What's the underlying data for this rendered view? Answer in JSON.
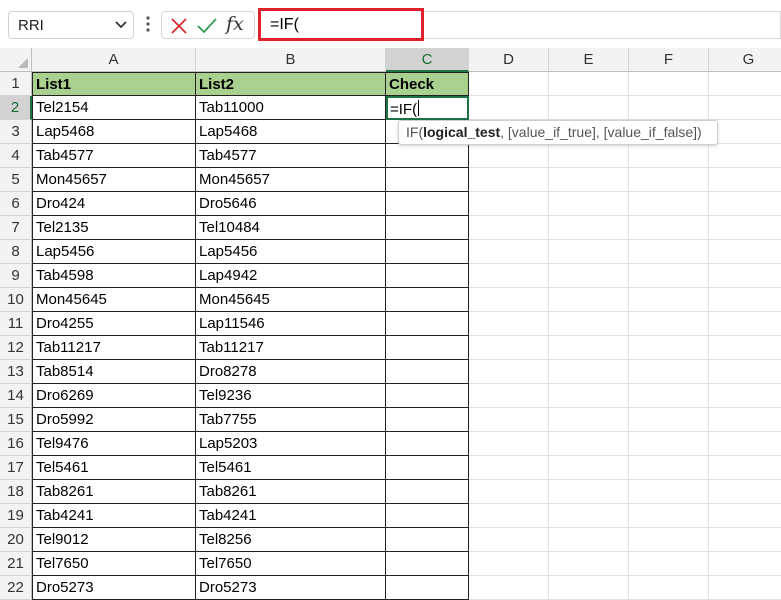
{
  "formula_bar": {
    "name_box": "RRI",
    "fx_label": "fx",
    "formula": "=IF("
  },
  "columns": [
    "A",
    "B",
    "C",
    "D",
    "E",
    "F",
    "G"
  ],
  "active_column": "C",
  "active_row": 2,
  "headers": [
    "List1",
    "List2",
    "Check"
  ],
  "rows": [
    {
      "num": "1",
      "a": "List1",
      "b": "List2",
      "c": "Check"
    },
    {
      "num": "2",
      "a": "Tel2154",
      "b": "Tab11000",
      "c": "=IF("
    },
    {
      "num": "3",
      "a": "Lap5468",
      "b": "Lap5468",
      "c": ""
    },
    {
      "num": "4",
      "a": "Tab4577",
      "b": "Tab4577",
      "c": ""
    },
    {
      "num": "5",
      "a": "Mon45657",
      "b": "Mon45657",
      "c": ""
    },
    {
      "num": "6",
      "a": "Dro424",
      "b": "Dro5646",
      "c": ""
    },
    {
      "num": "7",
      "a": "Tel2135",
      "b": "Tel10484",
      "c": ""
    },
    {
      "num": "8",
      "a": "Lap5456",
      "b": "Lap5456",
      "c": ""
    },
    {
      "num": "9",
      "a": "Tab4598",
      "b": "Lap4942",
      "c": ""
    },
    {
      "num": "10",
      "a": "Mon45645",
      "b": "Mon45645",
      "c": ""
    },
    {
      "num": "11",
      "a": "Dro4255",
      "b": "Lap11546",
      "c": ""
    },
    {
      "num": "12",
      "a": "Tab11217",
      "b": "Tab11217",
      "c": ""
    },
    {
      "num": "13",
      "a": "Tab8514",
      "b": "Dro8278",
      "c": ""
    },
    {
      "num": "14",
      "a": "Dro6269",
      "b": "Tel9236",
      "c": ""
    },
    {
      "num": "15",
      "a": "Dro5992",
      "b": "Tab7755",
      "c": ""
    },
    {
      "num": "16",
      "a": "Tel9476",
      "b": "Lap5203",
      "c": ""
    },
    {
      "num": "17",
      "a": "Tel5461",
      "b": "Tel5461",
      "c": ""
    },
    {
      "num": "18",
      "a": "Tab8261",
      "b": "Tab8261",
      "c": ""
    },
    {
      "num": "19",
      "a": "Tab4241",
      "b": "Tab4241",
      "c": ""
    },
    {
      "num": "20",
      "a": "Tel9012",
      "b": "Tel8256",
      "c": ""
    },
    {
      "num": "21",
      "a": "Tel7650",
      "b": "Tel7650",
      "c": ""
    },
    {
      "num": "22",
      "a": "Dro5273",
      "b": "Dro5273",
      "c": ""
    }
  ],
  "tooltip": {
    "fn": "IF(",
    "arg1": "logical_test",
    "rest": ", [value_if_true], [value_if_false])"
  },
  "colors": {
    "header_fill": "#a9d08e",
    "active_border": "#1e7145",
    "highlight_box": "#e0202a"
  }
}
